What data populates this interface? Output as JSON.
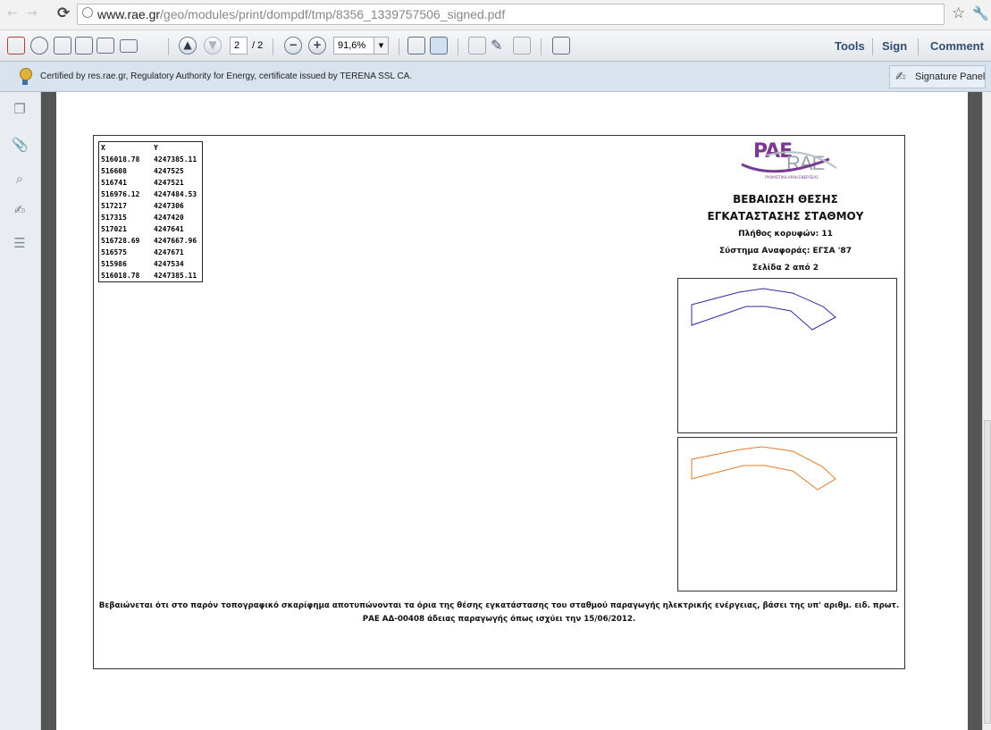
{
  "browser": {
    "url_host": "www.rae.gr",
    "url_path": "/geo/modules/print/dompdf/tmp/8356_1339757506_signed.pdf"
  },
  "toolbar": {
    "page_current": "2",
    "page_total": "/ 2",
    "zoom": "91,6%",
    "tools_label": "Tools",
    "sign_label": "Sign",
    "comment_label": "Comment"
  },
  "cert_bar": {
    "text": "Certified by res.rae.gr, Regulatory Authority for Energy, certificate issued by TERENA SSL CA.",
    "signature_panel_label": "Signature Panel"
  },
  "document": {
    "coords": {
      "header": [
        "X",
        "Y"
      ],
      "rows": [
        [
          "516018.78",
          "4247385.11"
        ],
        [
          "516608",
          "4247525"
        ],
        [
          "516741",
          "4247521"
        ],
        [
          "516976.12",
          "4247484.53"
        ],
        [
          "517217",
          "4247306"
        ],
        [
          "517315",
          "4247420"
        ],
        [
          "517021",
          "4247641"
        ],
        [
          "516728.69",
          "4247667.96"
        ],
        [
          "516575",
          "4247671"
        ],
        [
          "515986",
          "4247534"
        ],
        [
          "516018.78",
          "4247385.11"
        ]
      ]
    },
    "logo_pae": "PAE",
    "logo_rae": "RAE",
    "logo_sub": "ΡΥΘΜΙΣΤΙΚΗ ΑΡΧΗ ΕΝΕΡΓΕΙΑΣ",
    "title_line1": "ΒΕΒΑΙΩΣΗ ΘΕΣΗΣ",
    "title_line2": "ΕΓΚΑΤΑΣΤΑΣΗΣ ΣΤΑΘΜΟΥ",
    "vertices": "Πλήθος κορυφών: 11",
    "reference_system": "Σύστημα Αναφοράς: ΕΓΣΑ '87",
    "page_info": "Σελίδα 2 από 2",
    "footer_line1": "Βεβαιώνεται ότι στο παρόν τοπογραφικό σκαρίφημα αποτυπώνονται τα όρια της θέσης εγκατάστασης του σταθμού παραγωγής ηλεκτρικής ενέργειας, βάσει της υπ' αριθμ. ειδ. πρωτ.",
    "footer_line2": "ΡΑΕ ΑΔ-00408 άδειας παραγωγής όπως ισχύει την 15/06/2012."
  },
  "colors": {
    "map1_outline": "#2e2e9a",
    "map2_outline": "#e07a2a",
    "logo_purple": "#7a3a8f"
  },
  "icons": [
    "back-icon",
    "forward-icon",
    "reload-icon",
    "page-icon",
    "star-icon",
    "wrench-icon",
    "create-pdf-icon",
    "export-icon",
    "edit-icon",
    "save-icon",
    "print-icon",
    "email-icon",
    "previous-page-icon",
    "next-page-icon",
    "zoom-out-icon",
    "zoom-in-icon",
    "fit-width-icon",
    "fit-page-icon",
    "read-mode-icon",
    "sign-icon",
    "fullscreen-icon",
    "certificate-ribbon-icon",
    "signature-panel-icon",
    "pages-icon",
    "attachments-icon",
    "search-icon",
    "signatures-icon",
    "layers-icon"
  ]
}
